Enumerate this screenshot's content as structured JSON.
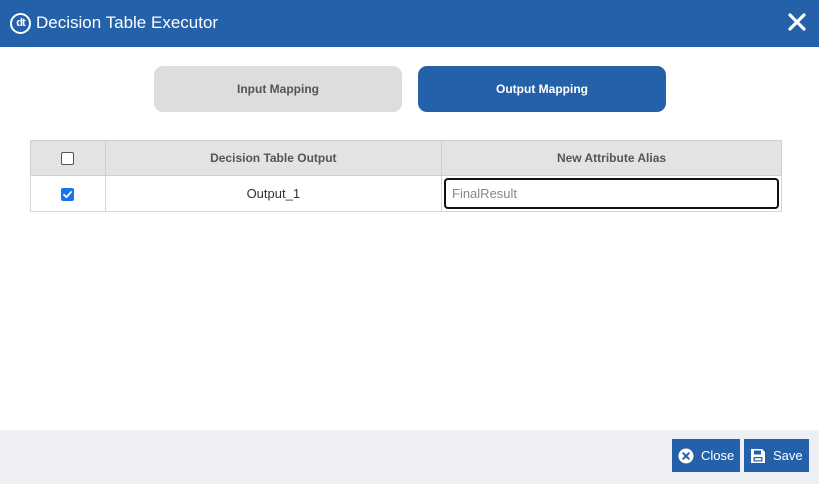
{
  "window": {
    "title": "Decision Table Executor",
    "logo_text": "dt",
    "close_icon": "close-icon",
    "accent_color": "#2561a8"
  },
  "mapping_tabs": {
    "input_label": "Input Mapping",
    "output_label": "Output Mapping",
    "active": "Output Mapping"
  },
  "table": {
    "columns": [
      "",
      "Decision Table Output",
      "New Attribute Alias"
    ],
    "header_select_all_checked": false,
    "rows": [
      {
        "checked": true,
        "output": "Output_1",
        "alias": "FinalResult"
      }
    ]
  },
  "footer": {
    "close_label": "Close",
    "save_label": "Save",
    "close_icon": "close-circle-icon",
    "save_icon": "save-disk-icon"
  }
}
